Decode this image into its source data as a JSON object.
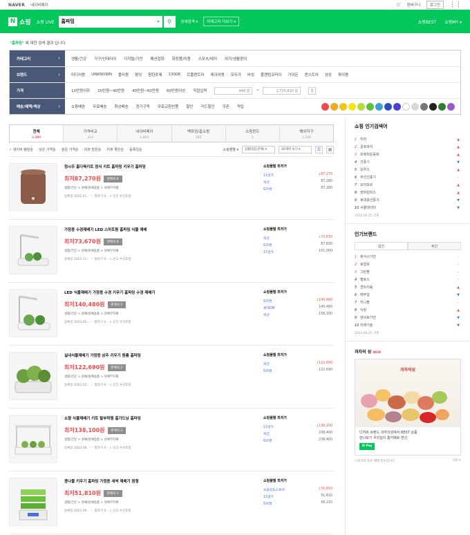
{
  "topbar": {
    "naver": "NAVER",
    "help": "네이버페이",
    "cart": "장바구니",
    "login": "로그인"
  },
  "header": {
    "logo_n": "N",
    "logo_text": "쇼핑",
    "live_tab": "쇼핑 LIVE",
    "query": "홈파밍",
    "detail_search": "상세검색 ▾",
    "category_more": "카테고리 더보기 ▾",
    "shop_best": "쇼핑BEST",
    "shop_my": "쇼핑MY ▾"
  },
  "notice": {
    "query": "\"홈파밍\"",
    "text": "에 대한 검색 결과 입니다."
  },
  "filters": {
    "category": {
      "label": "카테고리",
      "items": [
        "생활/건강",
        "가구/인테리어",
        "디지털/가전",
        "패션잡화",
        "화장품/미용",
        "스포츠/레저",
        "여가/생활편의"
      ]
    },
    "brand": {
      "label": "브랜드",
      "items": [
        "미디어팡",
        "UNKNOWN",
        "플리팜",
        "팜잇",
        "팜한포레",
        "1300K",
        "르플랜트리",
        "레이어원",
        "모두가",
        "비쉿",
        "플랜텀코리아",
        "가이든",
        "앤스트어",
        "상상",
        "파이팜"
      ]
    },
    "price": {
      "label": "가격",
      "items": [
        "10만원이하",
        "20만원~40만원",
        "40만원~60만원",
        "60만원이상"
      ],
      "direct": "직접입력",
      "min": "440 원",
      "max": "1,725,810 원"
    },
    "benefit": {
      "label": "배송/혜택/색상",
      "items": [
        "쇼핑배송",
        "무료배송",
        "최상배송",
        "정기구독",
        "무료교환반품",
        "할인",
        "카드할인",
        "쿠폰",
        "적립"
      ],
      "colors": [
        "#f24a4a",
        "#f5a623",
        "#f0c419",
        "#f5e31b",
        "#b6d93b",
        "#5fbf3a",
        "#3aa0d8",
        "#2a4fbf",
        "#4a3fd6",
        "#ffffff",
        "#d8d8d8",
        "#777777",
        "#222222",
        "#2e7d32",
        "#9b59d0"
      ]
    }
  },
  "tabs": [
    {
      "label": "전체",
      "count": "2,389"
    },
    {
      "label": "가격비교",
      "count": "214"
    },
    {
      "label": "네이버페이",
      "count": "1,803"
    },
    {
      "label": "백화점/홈쇼핑",
      "count": "185"
    },
    {
      "label": "쇼핑윈도",
      "count": "1"
    },
    {
      "label": "해외직구",
      "count": "1,320"
    }
  ],
  "sortbar": {
    "opts": [
      "✓ 네이버 랭킹순",
      "· 낮은 가격순",
      "· 높은 가격순",
      "· 리뷰 많은순",
      "· 리뷰 좋은순",
      "· 등록일순"
    ],
    "mall_label": "쇼핑몰별 ▾",
    "sel1": "상품타입(전체) ▾",
    "sel2": "40개씩 보기 ▾"
  },
  "products": [
    {
      "title": "정시주 홈다육키트 정식 키트 홈파밍 키우기 홈파밍",
      "price": "최저87,270원",
      "badge": "판매처 8",
      "cat": "생활/건강 > 원예/원예용품 > 원예부자재",
      "meta": "등록일 2022.01. · ♡ 찜하기 0 · ⚠ 신고 수신조정",
      "mall_head": "쇼핑몰별 최저가",
      "malls": [
        {
          "n": "11번가",
          "p": "87,270",
          "red": true
        },
        {
          "n": "옥션",
          "p": "87,280",
          "red": false
        },
        {
          "n": "G마켓",
          "p": "87,280",
          "red": false
        }
      ]
    },
    {
      "title": "가정용 수경재배기 LED 스마트팜 홈파밍 식물 재배",
      "price": "최저73,670원",
      "badge": "판매처 8",
      "cat": "생활/건강 > 원예/원예용품 > 원예부자재",
      "meta": "등록일 2022.11. · ♡ 찜하기 0 · ⚠ 신고 수신조정",
      "mall_head": "쇼핑몰별 최저가",
      "malls": [
        {
          "n": "옥션",
          "p": "73,670",
          "red": true
        },
        {
          "n": "G마켓",
          "p": "87,830",
          "red": false
        },
        {
          "n": "11번가",
          "p": "101,000",
          "red": false
        }
      ]
    },
    {
      "title": "LED 식물재배기 가정용 수경 키우기 홈파밍 수경 재배기",
      "price": "최저140,480원",
      "badge": "판매처 2",
      "cat": "생활/건강 > 원예/원예용품 > 원예부자재",
      "meta": "등록일 2022.05. · ♡ 찜하기 0 · ⚠ 신고 수신조정",
      "mall_head": "쇼핑몰별 최저가",
      "malls": [
        {
          "n": "G마켓",
          "p": "140,480",
          "red": true
        },
        {
          "n": "롯데ON",
          "p": "140,480",
          "red": false
        },
        {
          "n": "옥션",
          "p": "156,100",
          "red": false
        }
      ]
    },
    {
      "title": "실내식물재배기 가정용 상추 키우기 원룸 홈파밍",
      "price": "최저122,690원",
      "badge": "판매처 2",
      "cat": "생활/건강 > 원예/원예용품 > 원예부자재",
      "meta": "등록일 2022.01. · ♡ 찜하기 0 · ⚠ 신고 수신조정",
      "mall_head": "쇼핑몰별 최저가",
      "malls": [
        {
          "n": "옥션",
          "p": "122,690",
          "red": true
        },
        {
          "n": "G마켓",
          "p": "122,690",
          "red": false
        }
      ]
    },
    {
      "title": "소형 식물재배기 키트 탈부착형 홈가드닝 홈파밍",
      "price": "최저138,100원",
      "badge": "판매처 3",
      "cat": "생활/건강 > 원예/원예용품 > 원예부자재",
      "meta": "등록일 2022.06. · ♡ 찜하기 0 · ⚠ 신고 수신조정",
      "mall_head": "쇼핑몰별 최저가",
      "malls": [
        {
          "n": "11번가",
          "p": "138,100",
          "red": true
        },
        {
          "n": "옥션",
          "p": "238,400",
          "red": false
        },
        {
          "n": "G마켓",
          "p": "238,400",
          "red": false
        }
      ]
    },
    {
      "title": "콩나물 키우기 홈파밍 가정용 새싹 재배기 원형",
      "price": "최저51,810원",
      "badge": "판매처 3",
      "cat": "생활/건강 > 원예/원예용품 > 원예부자재",
      "meta": "등록일 2022.06. · ♡ 찜하기 0 · ⚠ 신고 수신조정",
      "mall_head": "쇼핑몰별 최저가",
      "malls": [
        {
          "n": "쇼핑윈도스토어",
          "p": "51,810",
          "red": true
        },
        {
          "n": "11번가",
          "p": "51,810",
          "red": false
        },
        {
          "n": "G마켓",
          "p": "56,210",
          "red": false
        }
      ]
    }
  ],
  "side": {
    "hot_title": "쇼핑 인기검색어",
    "hot": [
      {
        "n": "1",
        "t": "자라",
        "a": "▲"
      },
      {
        "n": "2",
        "t": "골프바지",
        "a": "▲"
      },
      {
        "n": "3",
        "t": "프레피운동화",
        "a": "▲"
      },
      {
        "n": "4",
        "t": "선풍기",
        "a": "▼"
      },
      {
        "n": "5",
        "t": "모루스",
        "a": "▲"
      },
      {
        "n": "6",
        "t": "무선선풍기",
        "a": "–"
      },
      {
        "n": "7",
        "t": "모어모르",
        "a": "▲"
      },
      {
        "n": "8",
        "t": "장마원피스",
        "a": "▲"
      },
      {
        "n": "9",
        "t": "휴대용선풍기",
        "a": "▼"
      },
      {
        "n": "10",
        "t": "서큘레이터",
        "a": "▼"
      }
    ],
    "hot_date": "2022.06.25 기준",
    "brand_title": "인기브랜드",
    "brand_tabs": [
      "일간",
      "주간"
    ],
    "brands": [
      {
        "n": "1",
        "t": "휘닉스가전",
        "a": "–"
      },
      {
        "n": "2",
        "t": "로얄포",
        "a": "–"
      },
      {
        "n": "3",
        "t": "그린팜",
        "a": "–"
      },
      {
        "n": "4",
        "t": "펠로스",
        "a": "–"
      },
      {
        "n": "5",
        "t": "센트리움",
        "a": "▲"
      },
      {
        "n": "6",
        "t": "에뚜알",
        "a": "▼"
      },
      {
        "n": "7",
        "t": "지니팜",
        "a": "–"
      },
      {
        "n": "8",
        "t": "닉맘",
        "a": "▲"
      },
      {
        "n": "9",
        "t": "엔씨토가전",
        "a": "▼"
      },
      {
        "n": "10",
        "t": "미래기술",
        "a": "▼"
      }
    ],
    "brand_date": "2022.06.25 기준",
    "ad_title": "과자의 성",
    "ad_new": "NEW",
    "ad_logo": "과자의성",
    "ad_text1": "디저트 브랜드 과자의성에서 BEST 상품",
    "ad_text2": "만나보기 우리집이 홈카페로 변신",
    "ad_pay": "N Pay",
    "ad_foot": "스토어의 최우 혜택 정보입니다",
    "ad_mark": "AD ✕"
  }
}
